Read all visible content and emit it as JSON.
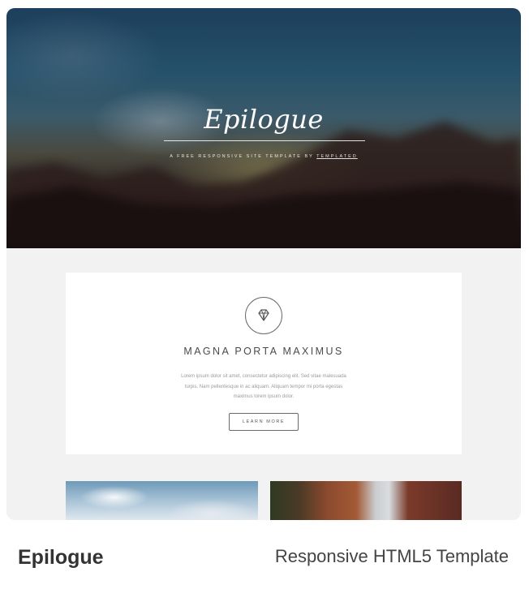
{
  "hero": {
    "title": "Epilogue",
    "subtitle_prefix": "A FREE RESPONSIVE SITE TEMPLATE BY ",
    "subtitle_link": "TEMPLATED"
  },
  "feature": {
    "icon": "diamond-icon",
    "title": "MAGNA PORTA MAXIMUS",
    "body": "Lorem ipsum dolor sit amet, consectetur adipiscing elit. Sed vitae malesuada turpis. Nam pellentesque in ac aliquam. Aliquam tempor mi porta egestas maximus lorem ipsum dolor.",
    "button_label": "LEARN MORE"
  },
  "caption": {
    "name": "Epilogue",
    "description": "Responsive HTML5 Template"
  },
  "colors": {
    "page_bg": "#f2f2f2",
    "box_bg": "#ffffff",
    "text_dark": "#333333"
  }
}
